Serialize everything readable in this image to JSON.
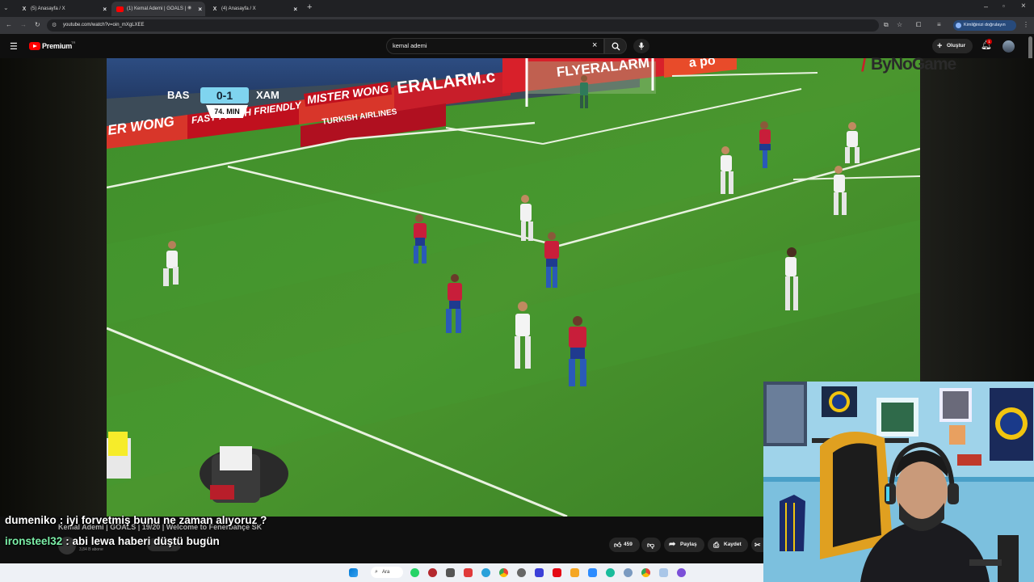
{
  "browser": {
    "tabs": [
      {
        "label": "(5) Anasayfa / X",
        "icon": "x-logo-icon",
        "active": false
      },
      {
        "label": "(1) Kemal Ademi | GOALS |",
        "icon": "youtube-icon",
        "active": true
      },
      {
        "label": "(4) Anasayfa / X",
        "icon": "x-logo-icon",
        "active": false
      }
    ],
    "url": "youtube.com/watch?v=oin_mXgLXEE",
    "verify_label": "Kimliğinizi doğrulayın"
  },
  "youtube": {
    "logo_label": "Premium",
    "region": "TR",
    "search_value": "kemal ademi",
    "create_label": "Oluştur",
    "notification_count": "1",
    "video_title": "Kemal Ademi | GOALS | 19/20 | Welcome to Fenerbahçe SK",
    "subscribers": "3,84 B abone",
    "like_count": "459",
    "share_label": "Paylaş",
    "save_label": "Kaydet"
  },
  "video": {
    "scoreboard": {
      "home": "BAS",
      "score": "0-1",
      "away": "XAM",
      "minute": "74. MIN"
    },
    "ads": [
      "ER WONG",
      "FAST FRESH FRIENDLY",
      "MISTER WONG",
      "ERALARM.c",
      "TURKISH AIRLINES",
      "FLYERALARM",
      "a po"
    ],
    "watermark": "ByNoGame"
  },
  "chat": [
    {
      "user": "dumeniko",
      "message": ": iyi forvetmiş bunu ne zaman alıyoruz ?"
    },
    {
      "user": "ironsteel32",
      "message": ": abi lewa haberi düştü bugün"
    }
  ],
  "taskbar": {
    "search_label": "Ara"
  },
  "colors": {
    "youtube_red": "#ff0000",
    "pitch_green": "#3b8a2a",
    "home_red": "#c81e3a",
    "chat_user2": "#7cf0a8"
  }
}
